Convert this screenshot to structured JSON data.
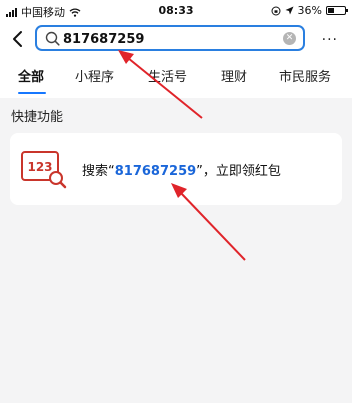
{
  "status_bar": {
    "carrier": "中国移动",
    "time": "08:33",
    "battery_percent": "36%",
    "battery_level": 0.36,
    "icons": [
      "signal-icon",
      "wifi-icon",
      "lock-rotation-icon",
      "location-icon",
      "battery-icon"
    ]
  },
  "search": {
    "value": "817687259",
    "back_icon": "chevron-left-icon",
    "search_icon": "search-icon",
    "clear_icon": "clear-icon",
    "more_label": "···"
  },
  "tabs": [
    {
      "label": "全部",
      "active": true
    },
    {
      "label": "小程序",
      "active": false
    },
    {
      "label": "生活号",
      "active": false
    },
    {
      "label": "理财",
      "active": false
    },
    {
      "label": "市民服务",
      "active": false
    }
  ],
  "section": {
    "title": "快捷功能"
  },
  "quick_action": {
    "icon_label": "123",
    "text_prefix": "搜索“",
    "number": "817687259",
    "text_suffix": "”，立即领红包"
  },
  "colors": {
    "accent": "#2a7fe0",
    "highlight": "#1a66d9",
    "annotation_arrow": "#e0242a",
    "icon_accent": "#c9352b"
  }
}
